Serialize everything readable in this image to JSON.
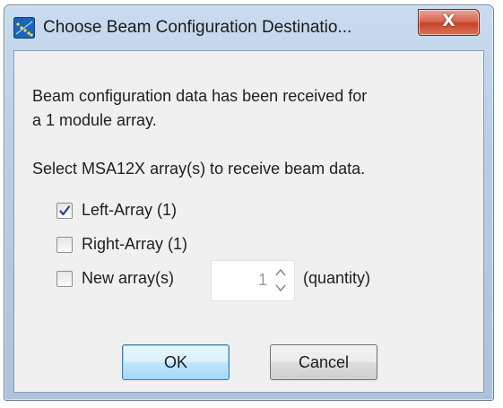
{
  "window": {
    "title": "Choose Beam Configuration Destinatio...",
    "close_label": "X"
  },
  "message": {
    "line1": "Beam configuration data has been received for",
    "line2": "a 1 module array.",
    "instruction": "Select MSA12X array(s) to receive beam data."
  },
  "options": [
    {
      "label": "Left-Array (1)",
      "checked": true
    },
    {
      "label": "Right-Array (1)",
      "checked": false
    },
    {
      "label": "New array(s)",
      "checked": false
    }
  ],
  "quantity": {
    "value": "1",
    "suffix": "(quantity)"
  },
  "buttons": {
    "ok": "OK",
    "cancel": "Cancel"
  },
  "colors": {
    "title_gradient_top": "#c9dbee",
    "close_button": "#c7432a",
    "client_bg": "#f0f0f0",
    "default_button": "#a7d9f5"
  },
  "icons": {
    "app": "app-icon",
    "check": "checkmark-icon",
    "spin_up": "caret-up-icon",
    "spin_down": "caret-down-icon"
  }
}
